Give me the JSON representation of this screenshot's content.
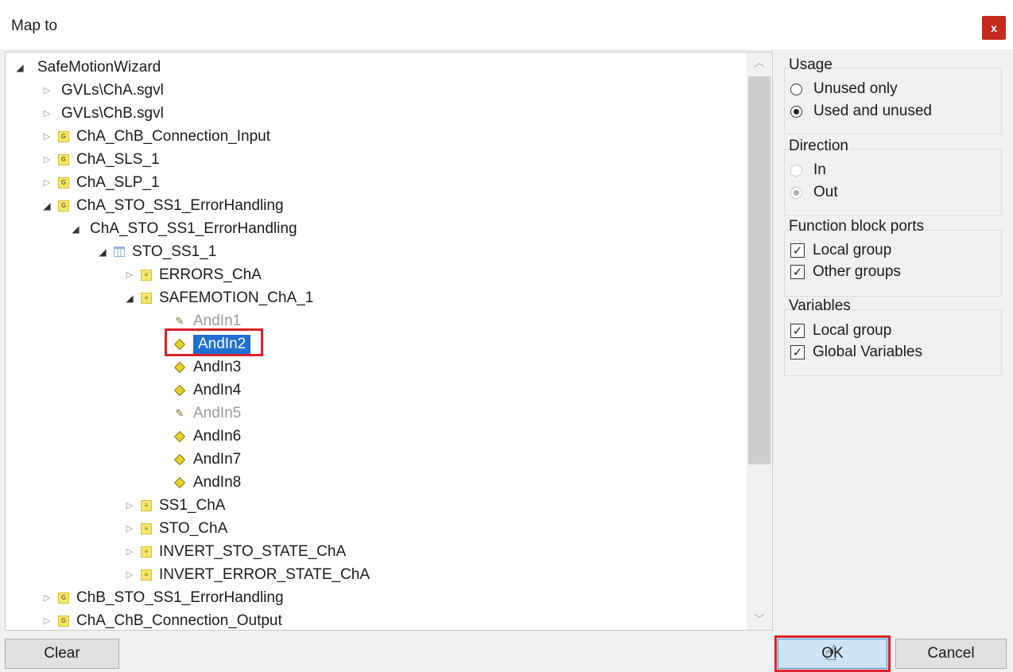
{
  "window": {
    "title": "Map to",
    "close_label": "x"
  },
  "tree": {
    "root": "SafeMotionWizard",
    "item_gvla": "GVLs\\ChA.sgvl",
    "item_gvlb": "GVLs\\ChB.sgvl",
    "item_conn_input": "ChA_ChB_Connection_Input",
    "item_sls": "ChA_SLS_1",
    "item_slp": "ChA_SLP_1",
    "item_sto_group": "ChA_STO_SS1_ErrorHandling",
    "item_sto_sub": "ChA_STO_SS1_ErrorHandling",
    "item_sto_fb": "STO_SS1_1",
    "item_errors": "ERRORS_ChA",
    "item_safemotion": "SAFEMOTION_ChA_1",
    "andin1": "AndIn1",
    "andin2": "AndIn2",
    "andin3": "AndIn3",
    "andin4": "AndIn4",
    "andin5": "AndIn5",
    "andin6": "AndIn6",
    "andin7": "AndIn7",
    "andin8": "AndIn8",
    "item_ss1": "SS1_ChA",
    "item_sto": "STO_ChA",
    "item_invert_sto": "INVERT_STO_STATE_ChA",
    "item_invert_error": "INVERT_ERROR_STATE_ChA",
    "item_chb_sto": "ChB_STO_SS1_ErrorHandling",
    "item_conn_output": "ChA_ChB_Connection_Output",
    "group_icon_glyph": "G",
    "port_icon_glyph": "≡"
  },
  "options": {
    "usage": {
      "title": "Usage",
      "unused_only": "Unused only",
      "used_and_unused": "Used and unused",
      "selected": "Used and unused"
    },
    "direction": {
      "title": "Direction",
      "in": "In",
      "out": "Out",
      "selected": "Out"
    },
    "fb_ports": {
      "title": "Function block ports",
      "local_group": "Local group",
      "other_groups": "Other groups"
    },
    "variables": {
      "title": "Variables",
      "local_group": "Local group",
      "global_variables": "Global Variables"
    },
    "check_glyph": "✓"
  },
  "buttons": {
    "clear": "Clear",
    "ok": "OK",
    "cancel": "Cancel"
  },
  "colors": {
    "selection": "#1f6fd1",
    "highlight_box": "#d8232a",
    "ok_button": "#cce4f7"
  }
}
